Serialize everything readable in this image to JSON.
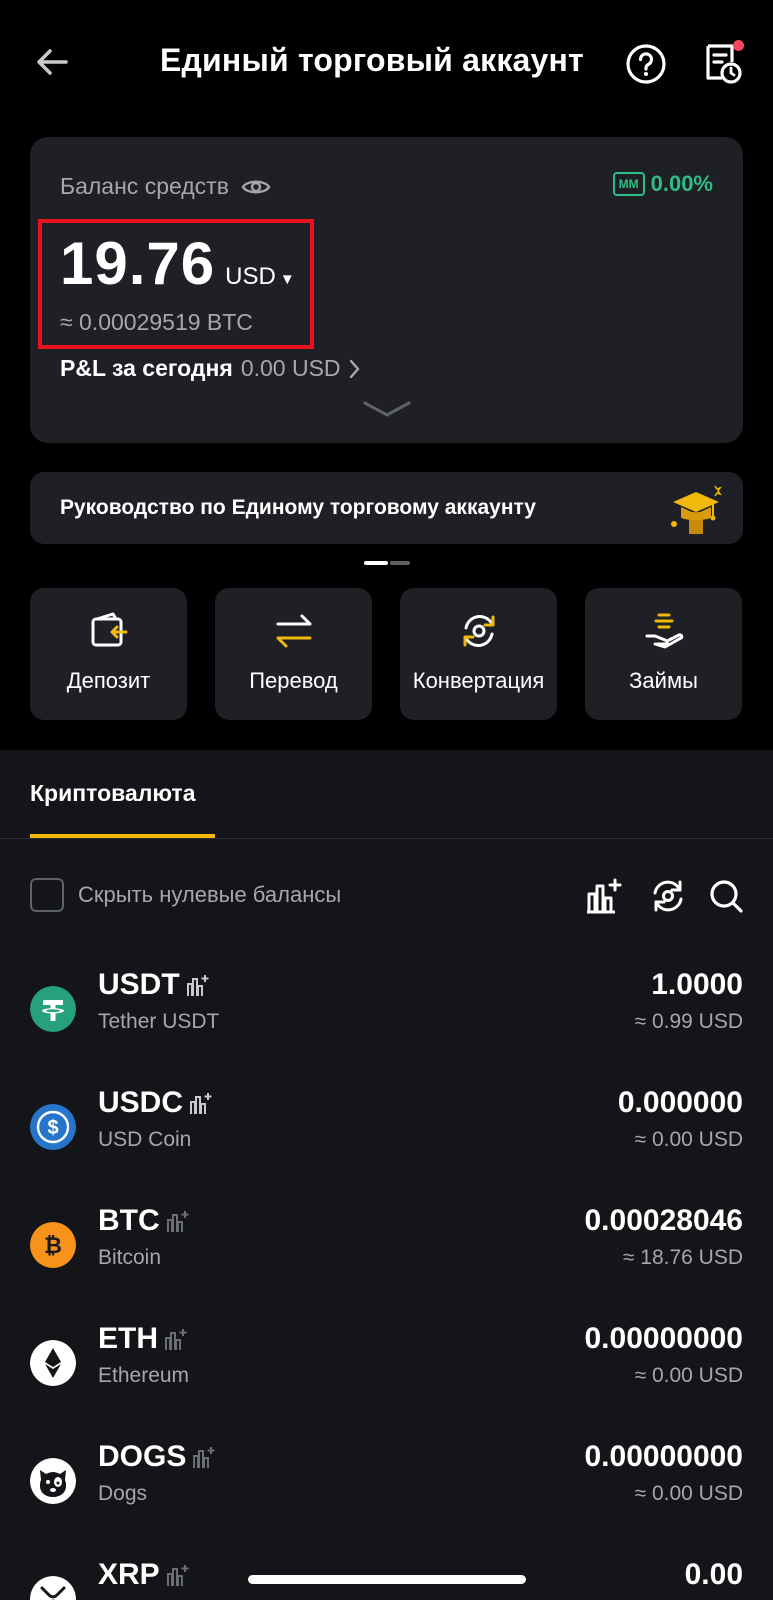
{
  "header": {
    "title": "Единый торговый аккаунт"
  },
  "balance": {
    "label": "Баланс средств",
    "mm_badge": "MM",
    "mm_value": "0.00%",
    "amount": "19.76",
    "currency": "USD",
    "btc_equivalent": "≈ 0.00029519 BTC",
    "pnl_label": "P&L за сегодня",
    "pnl_value": "0.00 USD"
  },
  "guide": {
    "text": "Руководство по Единому торговому аккаунту"
  },
  "actions": [
    {
      "label": "Депозит",
      "icon": "wallet-icon"
    },
    {
      "label": "Перевод",
      "icon": "transfer-icon"
    },
    {
      "label": "Конвертация",
      "icon": "convert-icon"
    },
    {
      "label": "Займы",
      "icon": "loan-icon"
    }
  ],
  "tabs": {
    "active": "Криптовалюта"
  },
  "filter": {
    "hide_zero_label": "Скрыть нулевые балансы",
    "hide_zero_checked": false
  },
  "assets": [
    {
      "symbol": "USDT",
      "name": "Tether USDT",
      "amount": "1.0000",
      "usd": "≈ 0.99 USD",
      "color": "#26a17b"
    },
    {
      "symbol": "USDC",
      "name": "USD Coin",
      "amount": "0.000000",
      "usd": "≈ 0.00 USD",
      "color": "#2775ca"
    },
    {
      "symbol": "BTC",
      "name": "Bitcoin",
      "amount": "0.00028046",
      "usd": "≈ 18.76 USD",
      "color": "#f7931a"
    },
    {
      "symbol": "ETH",
      "name": "Ethereum",
      "amount": "0.00000000",
      "usd": "≈ 0.00 USD",
      "color": "#ffffff"
    },
    {
      "symbol": "DOGS",
      "name": "Dogs",
      "amount": "0.00000000",
      "usd": "≈ 0.00 USD",
      "color": "#ffffff"
    },
    {
      "symbol": "XRP",
      "name": "",
      "amount": "0.00",
      "usd": "",
      "color": "#ffffff"
    }
  ],
  "colors": {
    "accent": "#f0b90b",
    "positive": "#2ebd85",
    "highlight": "#e8101b",
    "card": "#1e2026"
  }
}
